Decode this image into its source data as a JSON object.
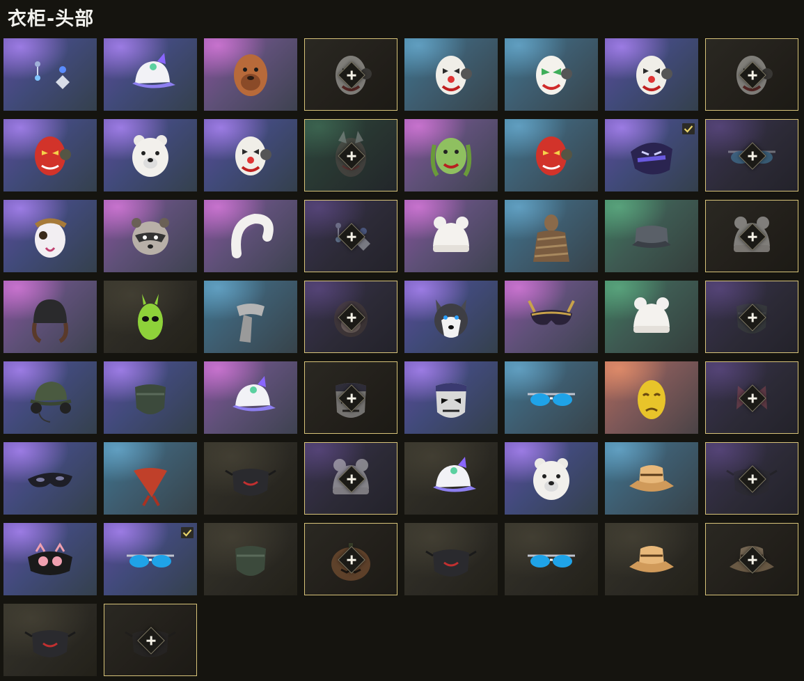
{
  "title": "衣柜-头部",
  "colors": {
    "locked_border": "#d8c47a",
    "check": "#e8d36a",
    "background": "#15140f"
  },
  "items": [
    {
      "name": "earrings",
      "bg": "purple",
      "locked": false,
      "equipped": false,
      "icon": "earrings-icon"
    },
    {
      "name": "cat-ear-cap",
      "bg": "purple",
      "locked": false,
      "equipped": false,
      "icon": "cap-icon"
    },
    {
      "name": "shar-pei-mask",
      "bg": "pink",
      "locked": false,
      "equipped": false,
      "icon": "dog-mask-icon"
    },
    {
      "name": "clown-mask-locked",
      "bg": "locked-dark",
      "locked": true,
      "equipped": false,
      "icon": "clown-mask-icon"
    },
    {
      "name": "chains-clown-mask",
      "bg": "blue",
      "locked": false,
      "equipped": false,
      "icon": "clown-mask-icon"
    },
    {
      "name": "joker-mask",
      "bg": "blue",
      "locked": false,
      "equipped": false,
      "icon": "joker-mask-icon"
    },
    {
      "name": "pink-clown-mask",
      "bg": "purple",
      "locked": false,
      "equipped": false,
      "icon": "clown-mask-icon"
    },
    {
      "name": "gray-clown-mask-locked",
      "bg": "locked-dark",
      "locked": true,
      "equipped": false,
      "icon": "clown-mask-icon"
    },
    {
      "name": "red-oni-mask",
      "bg": "purple",
      "locked": false,
      "equipped": false,
      "icon": "oni-mask-icon"
    },
    {
      "name": "polar-bear-head",
      "bg": "purple",
      "locked": false,
      "equipped": false,
      "icon": "bear-head-icon"
    },
    {
      "name": "blue-clown-mask",
      "bg": "purple",
      "locked": false,
      "equipped": false,
      "icon": "clown-mask-icon"
    },
    {
      "name": "demon-mask-locked",
      "bg": "locked-green",
      "locked": true,
      "equipped": false,
      "icon": "demon-mask-icon"
    },
    {
      "name": "medusa-mask",
      "bg": "pink",
      "locked": false,
      "equipped": false,
      "icon": "medusa-mask-icon"
    },
    {
      "name": "red-hannya-mask",
      "bg": "blue",
      "locked": false,
      "equipped": false,
      "icon": "oni-mask-icon"
    },
    {
      "name": "purple-beast-mask",
      "bg": "purple",
      "locked": false,
      "equipped": true,
      "icon": "beast-mask-icon"
    },
    {
      "name": "sunglasses-locked",
      "bg": "locked-purple",
      "locked": true,
      "equipped": false,
      "icon": "sunglasses-icon"
    },
    {
      "name": "steampunk-mask",
      "bg": "purple",
      "locked": false,
      "equipped": false,
      "icon": "steampunk-mask-icon"
    },
    {
      "name": "raccoon-head",
      "bg": "pink",
      "locked": false,
      "equipped": false,
      "icon": "raccoon-head-icon"
    },
    {
      "name": "fur-earmuffs",
      "bg": "pink",
      "locked": false,
      "equipped": false,
      "icon": "earmuffs-icon"
    },
    {
      "name": "earrings-locked",
      "bg": "locked-purple",
      "locked": true,
      "equipped": false,
      "icon": "earrings-icon"
    },
    {
      "name": "bear-ear-beanie",
      "bg": "pink",
      "locked": false,
      "equipped": false,
      "icon": "beanie-icon"
    },
    {
      "name": "mummy-outfit",
      "bg": "blue",
      "locked": false,
      "equipped": false,
      "icon": "mummy-icon"
    },
    {
      "name": "gray-patrol-cap",
      "bg": "green",
      "locked": false,
      "equipped": false,
      "icon": "patrol-cap-icon"
    },
    {
      "name": "black-beanie-locked",
      "bg": "locked-dark",
      "locked": true,
      "equipped": false,
      "icon": "beanie-icon"
    },
    {
      "name": "hooded-helmet",
      "bg": "pink",
      "locked": false,
      "equipped": false,
      "icon": "helmet-icon"
    },
    {
      "name": "green-alien-mask",
      "bg": "dark",
      "locked": false,
      "equipped": false,
      "icon": "alien-mask-icon"
    },
    {
      "name": "gray-scarf",
      "bg": "blue",
      "locked": false,
      "equipped": false,
      "icon": "scarf-icon"
    },
    {
      "name": "monkey-mask-locked",
      "bg": "locked-purple",
      "locked": true,
      "equipped": false,
      "icon": "monkey-mask-icon"
    },
    {
      "name": "husky-head",
      "bg": "purple",
      "locked": false,
      "equipped": false,
      "icon": "husky-head-icon"
    },
    {
      "name": "gold-masquerade-mask",
      "bg": "pink",
      "locked": false,
      "equipped": false,
      "icon": "masquerade-mask-icon"
    },
    {
      "name": "pom-pom-beanie",
      "bg": "green",
      "locked": false,
      "equipped": false,
      "icon": "beanie-icon"
    },
    {
      "name": "face-wrap-locked",
      "bg": "locked-purple",
      "locked": true,
      "equipped": false,
      "icon": "face-wrap-icon"
    },
    {
      "name": "headset-cap",
      "bg": "purple",
      "locked": false,
      "equipped": false,
      "icon": "headset-icon"
    },
    {
      "name": "camo-face-wrap",
      "bg": "purple",
      "locked": false,
      "equipped": false,
      "icon": "face-wrap-icon"
    },
    {
      "name": "black-baseball-cap",
      "bg": "pink",
      "locked": false,
      "equipped": false,
      "icon": "cap-icon"
    },
    {
      "name": "gold-skull-mask-locked",
      "bg": "locked-dark",
      "locked": true,
      "equipped": false,
      "icon": "skull-mask-icon"
    },
    {
      "name": "punisher-mask",
      "bg": "purple",
      "locked": false,
      "equipped": false,
      "icon": "skull-mask-icon"
    },
    {
      "name": "red-sport-glasses",
      "bg": "blue",
      "locked": false,
      "equipped": false,
      "icon": "sunglasses-icon"
    },
    {
      "name": "gold-theater-mask",
      "bg": "orange",
      "locked": false,
      "equipped": false,
      "icon": "theater-mask-icon"
    },
    {
      "name": "red-bow-locked",
      "bg": "locked-purple",
      "locked": true,
      "equipped": false,
      "icon": "bow-icon"
    },
    {
      "name": "black-eye-mask",
      "bg": "purple",
      "locked": false,
      "equipped": false,
      "icon": "eye-mask-icon"
    },
    {
      "name": "red-bandana",
      "bg": "blue",
      "locked": false,
      "equipped": false,
      "icon": "bandana-icon"
    },
    {
      "name": "black-face-mask",
      "bg": "dark",
      "locked": false,
      "equipped": false,
      "icon": "face-mask-icon"
    },
    {
      "name": "pom-beanie-locked",
      "bg": "locked-purple",
      "locked": true,
      "equipped": false,
      "icon": "beanie-icon"
    },
    {
      "name": "red-stripe-cap",
      "bg": "dark",
      "locked": false,
      "equipped": false,
      "icon": "cap-icon"
    },
    {
      "name": "brown-bear-head",
      "bg": "purple",
      "locked": false,
      "equipped": false,
      "icon": "bear-head-icon"
    },
    {
      "name": "bucket-hat",
      "bg": "blue",
      "locked": false,
      "equipped": false,
      "icon": "bucket-hat-icon"
    },
    {
      "name": "skull-face-mask-locked",
      "bg": "locked-purple",
      "locked": true,
      "equipped": false,
      "icon": "face-mask-icon"
    },
    {
      "name": "cat-sleep-mask",
      "bg": "purple",
      "locked": false,
      "equipped": false,
      "icon": "sleep-mask-icon"
    },
    {
      "name": "blue-shield-glasses",
      "bg": "purple",
      "locked": false,
      "equipped": true,
      "icon": "sunglasses-icon"
    },
    {
      "name": "hooded-scarf",
      "bg": "dark",
      "locked": false,
      "equipped": false,
      "icon": "face-wrap-icon"
    },
    {
      "name": "pumpkin-head-locked",
      "bg": "locked-dark",
      "locked": true,
      "equipped": false,
      "icon": "pumpkin-icon"
    },
    {
      "name": "mouth-face-mask",
      "bg": "dark",
      "locked": false,
      "equipped": false,
      "icon": "face-mask-icon"
    },
    {
      "name": "yellow-goggles",
      "bg": "dark",
      "locked": false,
      "equipped": false,
      "icon": "sunglasses-icon"
    },
    {
      "name": "shark-bucket-hat",
      "bg": "dark",
      "locked": false,
      "equipped": false,
      "icon": "bucket-hat-icon"
    },
    {
      "name": "dark-hat-locked",
      "bg": "locked-dark",
      "locked": true,
      "equipped": false,
      "icon": "bucket-hat-icon"
    },
    {
      "name": "tactical-face-mask",
      "bg": "dark",
      "locked": false,
      "equipped": false,
      "icon": "face-mask-icon"
    },
    {
      "name": "fang-face-mask-locked",
      "bg": "locked-dark",
      "locked": true,
      "equipped": false,
      "icon": "face-mask-icon"
    }
  ]
}
